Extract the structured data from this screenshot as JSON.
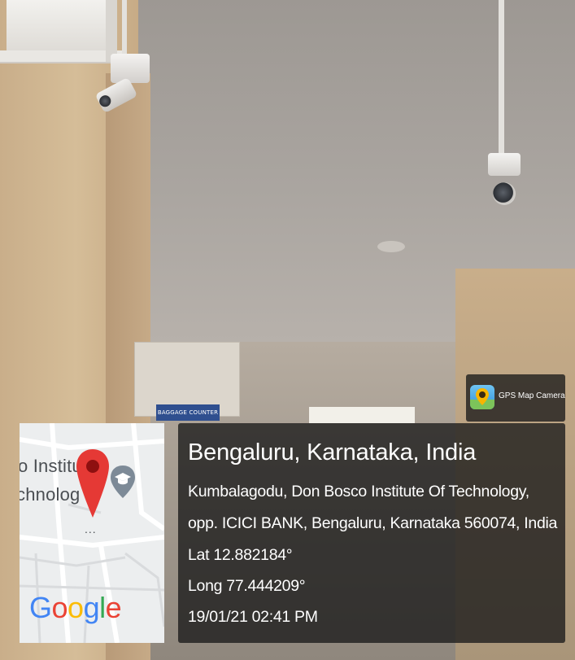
{
  "photo": {
    "description_icons": [
      "cctv-camera-icon",
      "cctv-camera-icon"
    ],
    "sign_text": "BAGGAGE COUNTER"
  },
  "badge": {
    "app_name": "GPS Map Camera",
    "icon": "gps-map-camera-icon"
  },
  "map": {
    "label_line1": "o Institu",
    "label_line2": "chnolog",
    "attribution": "Google",
    "pin_icon": "map-pin-icon",
    "poi_icon": "education-marker-icon",
    "dots": "..."
  },
  "location": {
    "title": "Bengaluru, Karnataka, India",
    "address_line1": "Kumbalagodu, Don Bosco Institute Of Technology,",
    "address_line2": "opp. ICICI BANK, Bengaluru, Karnataka 560074, India",
    "latitude": "Lat 12.882184°",
    "longitude": "Long 77.444209°",
    "datetime": "19/01/21 02:41 PM"
  },
  "colors": {
    "panel_bg": "#191919",
    "pin_red": "#e53935",
    "google_blue": "#4285F4",
    "google_red": "#EA4335",
    "google_yellow": "#FBBC05",
    "google_green": "#34A853"
  }
}
